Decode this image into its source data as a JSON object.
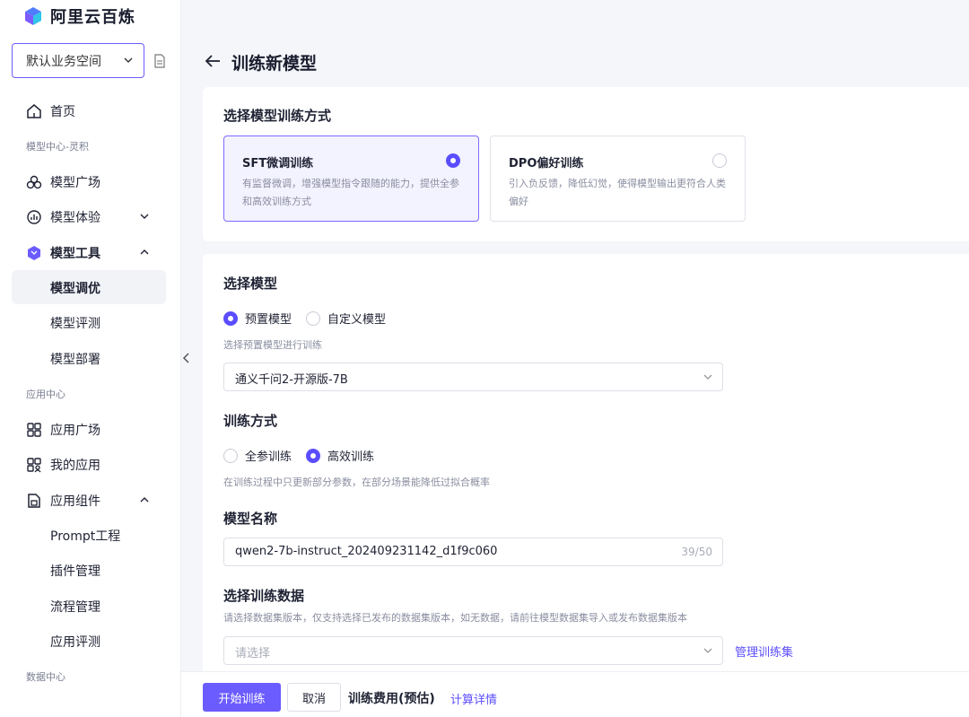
{
  "brand": {
    "name": "阿里云百炼"
  },
  "workspace": {
    "label": "默认业务空间"
  },
  "sidebar": {
    "home": "首页",
    "section_model": "模型中心-灵积",
    "model_square": "模型广场",
    "model_experience": "模型体验",
    "model_tools": "模型工具",
    "model_tuning": "模型调优",
    "model_eval": "模型评测",
    "model_deploy": "模型部署",
    "section_app": "应用中心",
    "app_square": "应用广场",
    "my_apps": "我的应用",
    "app_components": "应用组件",
    "prompt_eng": "Prompt工程",
    "plugin_mgmt": "插件管理",
    "flow_mgmt": "流程管理",
    "app_eval": "应用评测",
    "section_data": "数据中心"
  },
  "page": {
    "title": "训练新模型"
  },
  "method": {
    "heading": "选择模型训练方式",
    "options": [
      {
        "title": "SFT微调训练",
        "desc": "有监督微调，增强模型指令跟随的能力，提供全参和高效训练方式",
        "selected": true
      },
      {
        "title": "DPO偏好训练",
        "desc": "引入负反馈，降低幻觉，使得模型输出更符合人类偏好",
        "selected": false
      }
    ]
  },
  "model": {
    "heading": "选择模型",
    "radio_preset": "预置模型",
    "radio_custom": "自定义模型",
    "hint": "选择预置模型进行训练",
    "selected": "通义千问2-开源版-7B"
  },
  "train_mode": {
    "heading": "训练方式",
    "radio_full": "全参训练",
    "radio_efficient": "高效训练",
    "hint": "在训练过程中只更新部分参数，在部分场景能降低过拟合概率"
  },
  "model_name": {
    "heading": "模型名称",
    "value": "qwen2-7b-instruct_202409231142_d1f9c060",
    "counter": "39/50"
  },
  "dataset": {
    "heading": "选择训练数据",
    "hint": "请选择数据集版本，仅支持选择已发布的数据集版本，如无数据，请前往模型数据集导入或发布数据集版本",
    "placeholder": "请选择",
    "manage_link": "管理训练集"
  },
  "footer": {
    "start": "开始训练",
    "cancel": "取消",
    "fee": "训练费用(预估)",
    "fee_detail": "计算详情"
  },
  "colors": {
    "accent": "#5b4dff",
    "button": "#6b5cff"
  }
}
